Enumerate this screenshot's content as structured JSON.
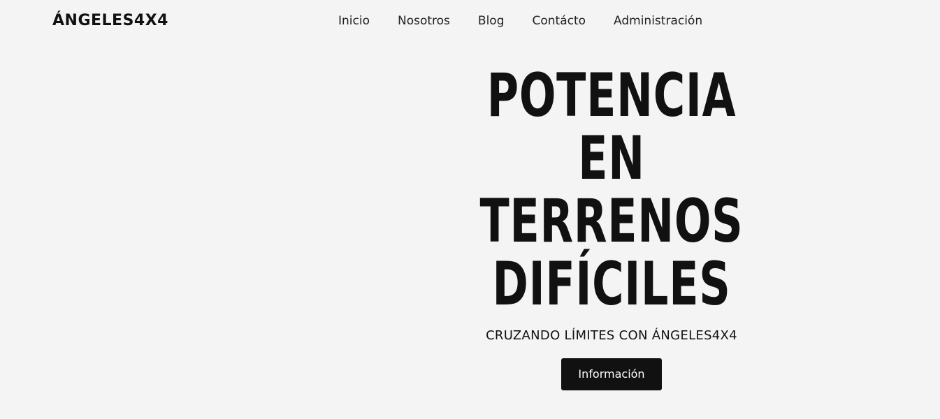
{
  "header": {
    "logo": "ÁNGELES4X4",
    "nav": [
      {
        "label": "Inicio"
      },
      {
        "label": "Nosotros"
      },
      {
        "label": "Blog"
      },
      {
        "label": "Contácto"
      },
      {
        "label": "Administración"
      }
    ]
  },
  "hero": {
    "title_lines": [
      "POTENCIA",
      "EN",
      "TERRENOS",
      "DIFÍCILES"
    ],
    "subtitle": "CRUZANDO LÍMITES CON ÁNGELES4X4",
    "button_label": "Información"
  }
}
